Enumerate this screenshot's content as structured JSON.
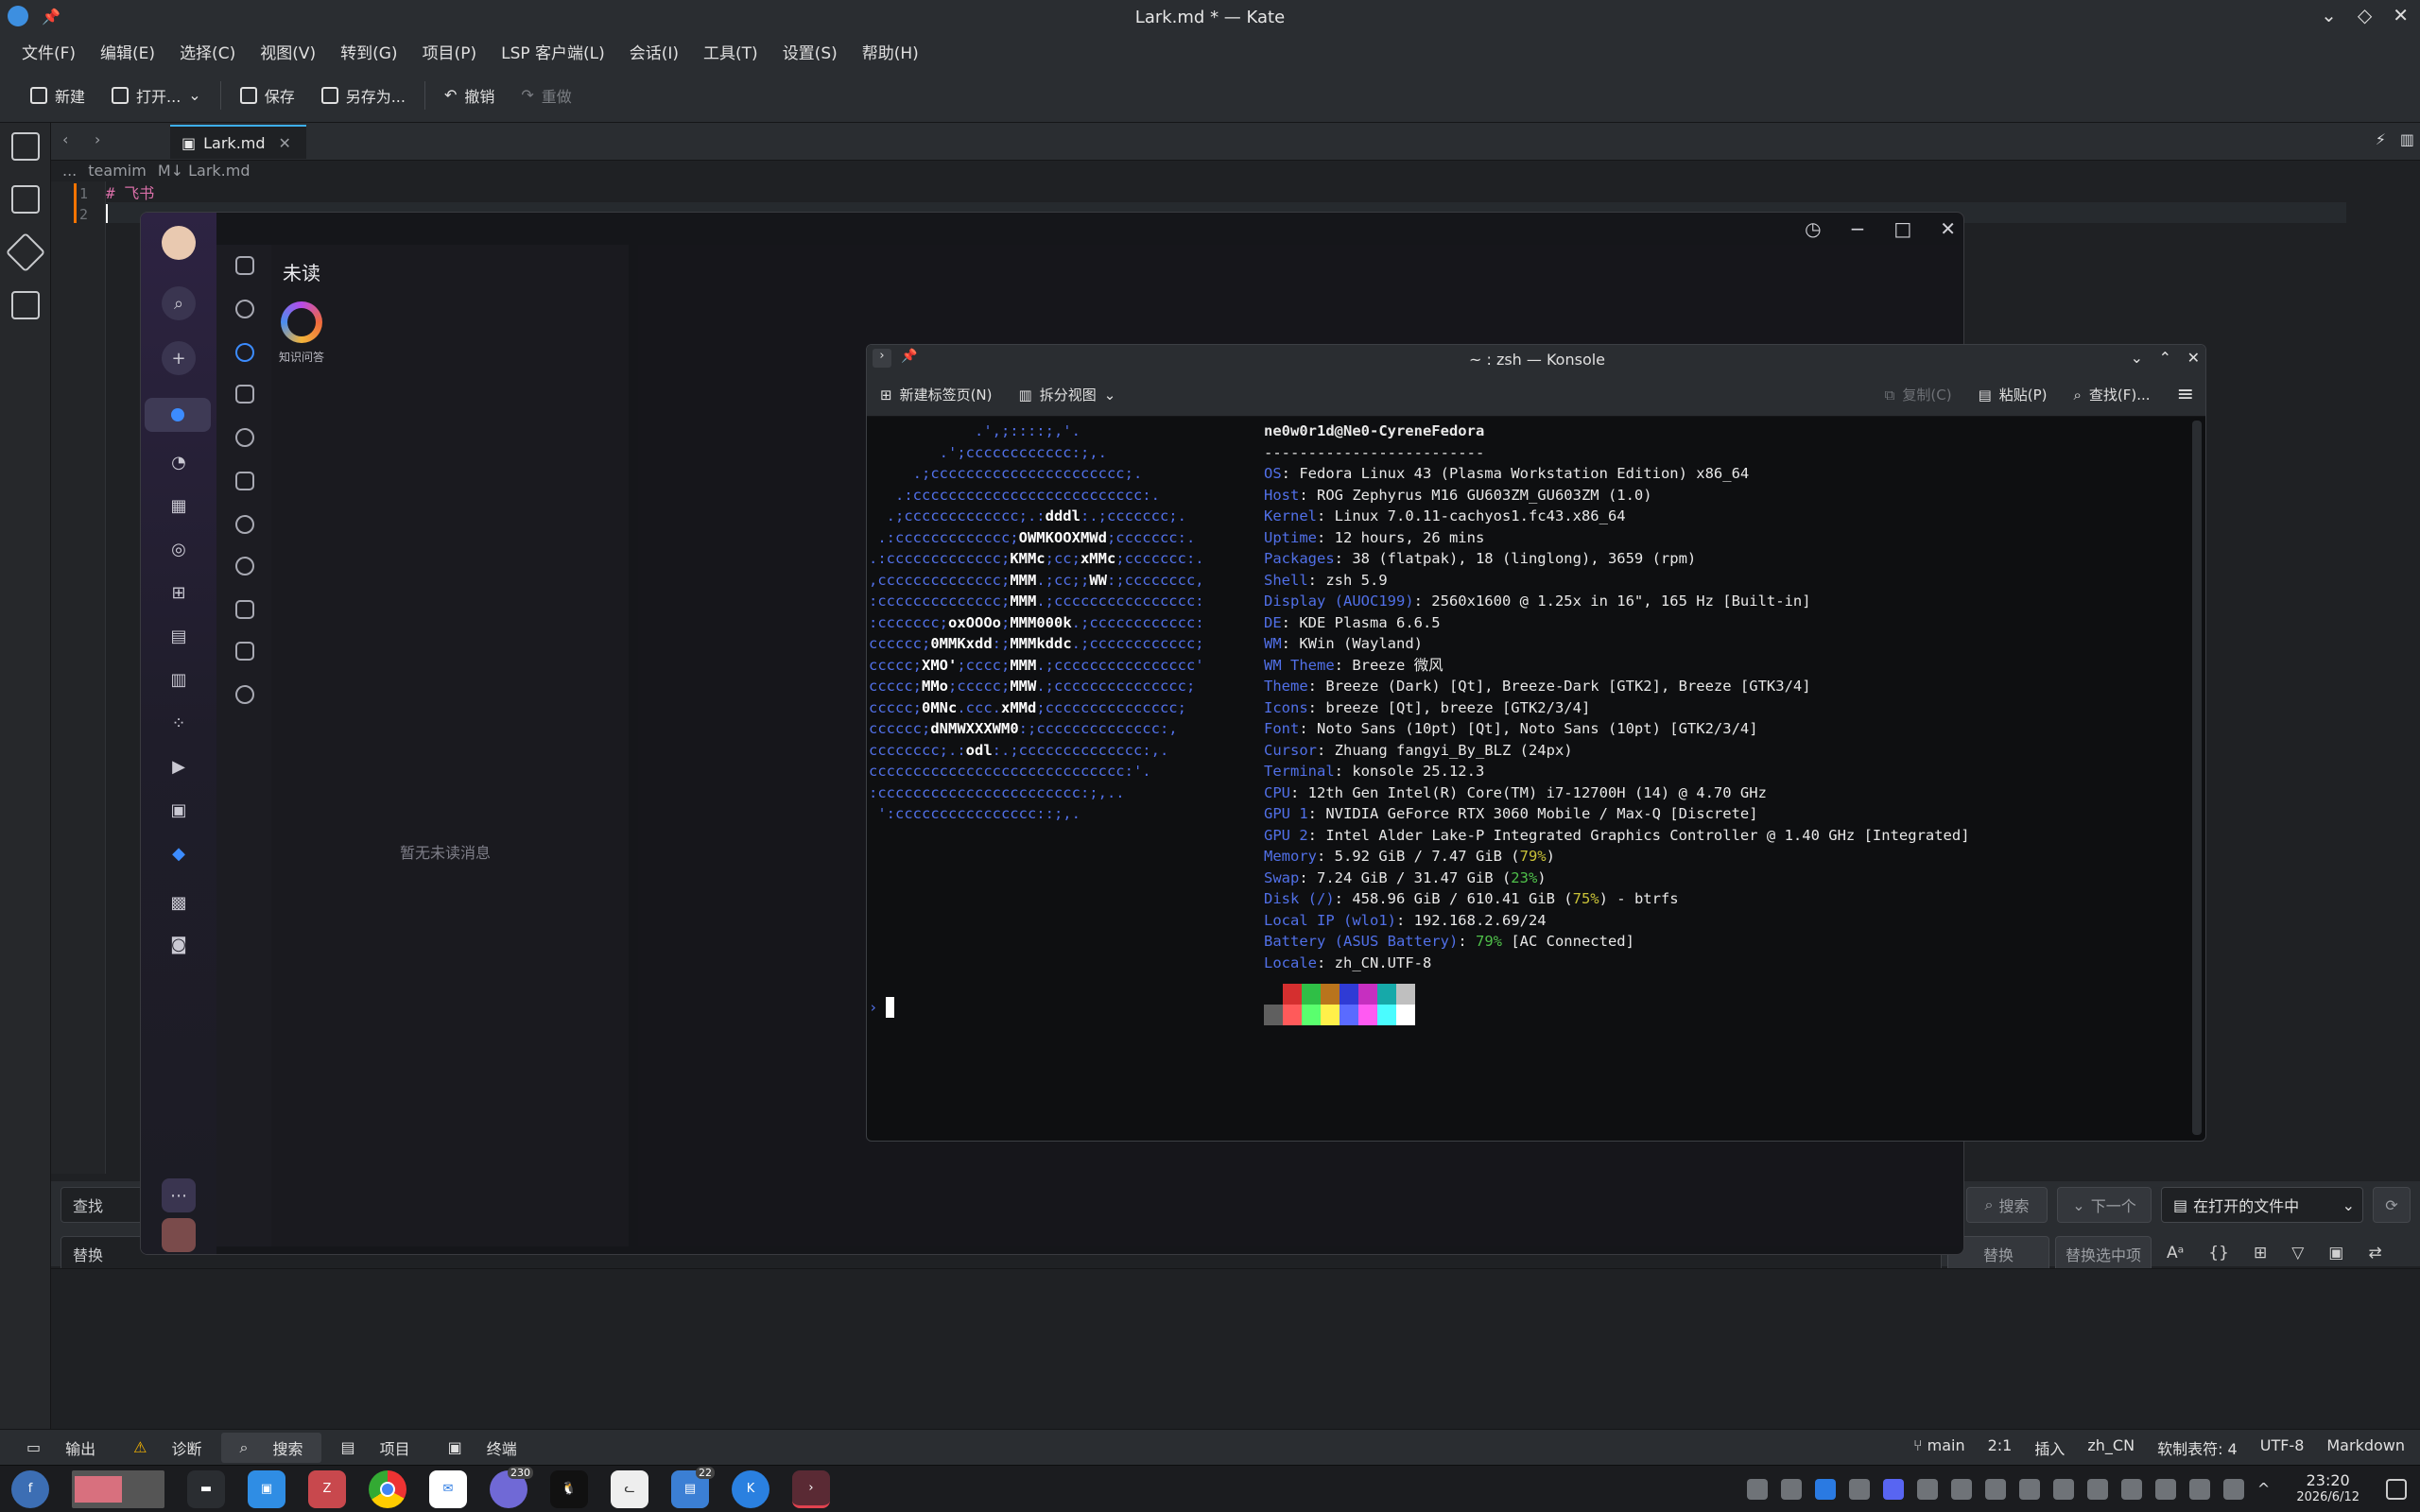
{
  "kate": {
    "window_title": "Lark.md * — Kate",
    "menu": [
      "文件(F)",
      "编辑(E)",
      "选择(C)",
      "视图(V)",
      "转到(G)",
      "项目(P)",
      "LSP 客户端(L)",
      "会话(I)",
      "工具(T)",
      "设置(S)",
      "帮助(H)"
    ],
    "toolbar": {
      "new": "新建",
      "open": "打开...",
      "save": "保存",
      "save_as": "另存为...",
      "undo": "撤销",
      "redo": "重做"
    },
    "tab_label": "Lark.md",
    "breadcrumb": [
      "...",
      "teamim",
      "M↓ Lark.md"
    ],
    "line_numbers": [
      "1",
      "2"
    ],
    "line1": "# 飞书",
    "find": {
      "find_placeholder": "查找",
      "replace_placeholder": "替换",
      "search": "搜索",
      "next": "下一个",
      "scope": "在打开的文件中",
      "replace": "替换",
      "replace_selected": "替换选中项"
    },
    "statusbar": {
      "tabs": [
        "输出",
        "诊断",
        "搜索",
        "项目",
        "终端"
      ],
      "branch": "main",
      "position": "2:1",
      "mode": "插入",
      "lang": "zh_CN",
      "tabs_setting": "软制表符: 4",
      "encoding": "UTF-8",
      "syntax": "Markdown"
    }
  },
  "feishu": {
    "list_title": "未读",
    "item_label": "知识问答",
    "empty_text": "暂无未读消息"
  },
  "konsole": {
    "title": "~ : zsh — Konsole",
    "toolbar": {
      "new_tab": "新建标签页(N)",
      "split": "拆分视图",
      "copy": "复制(C)",
      "paste": "粘贴(P)",
      "find": "查找(F)..."
    },
    "logo_lines": [
      "            .',;::::;,'.",
      "        .';cccccccccccc:;,.",
      "     .;cccccccccccccccccccccc;.",
      "   .:cccccccccccccccccccccccccc:.",
      "  .;ccccccccccccc;.:dddl:.;ccccccc;.",
      " .:ccccccccccccc;OWMKOOXMWd;ccccccc:.",
      ".:ccccccccccccc;KMMc;cc;xMMc;ccccccc:.",
      ",cccccccccccccc;MMM.;cc;;WW:;cccccccc,",
      ":cccccccccccccc;MMM.;cccccccccccccccc:",
      ":ccccccc;oxOOOo;MMM000k.;cccccccccccc:",
      "cccccc;0MMKxdd:;MMMkddc.;cccccccccccc;",
      "ccccc;XMO';cccc;MMM.;cccccccccccccccc'",
      "ccccc;MMo;ccccc;MMW.;ccccccccccccccc;",
      "ccccc;0MNc.ccc.xMMd;ccccccccccccccc;",
      "cccccc;dNMWXXXWM0:;cccccccccccccc:,",
      "cccccccc;.:odl:.;cccccccccccccc:,.",
      "ccccccccccccccccccccccccccccc:'.",
      ":ccccccccccccccccccccccc:;,..",
      " ':cccccccccccccccc::;,."
    ],
    "user_host": "ne0w0r1d@Ne0-CyreneFedora",
    "separator": "-------------------------",
    "info": [
      {
        "k": "OS",
        "v": ": Fedora Linux 43 (Plasma Workstation Edition) x86_64"
      },
      {
        "k": "Host",
        "v": ": ROG Zephyrus M16 GU603ZM_GU603ZM (1.0)"
      },
      {
        "k": "Kernel",
        "v": ": Linux 7.0.11-cachyos1.fc43.x86_64"
      },
      {
        "k": "Uptime",
        "v": ": 12 hours, 26 mins"
      },
      {
        "k": "Packages",
        "v": ": 38 (flatpak), 18 (linglong), 3659 (rpm)"
      },
      {
        "k": "Shell",
        "v": ": zsh 5.9"
      },
      {
        "k": "Display (AUOC199)",
        "v": ": 2560x1600 @ 1.25x in 16\", 165 Hz [Built-in]"
      },
      {
        "k": "DE",
        "v": ": KDE Plasma 6.6.5"
      },
      {
        "k": "WM",
        "v": ": KWin (Wayland)"
      },
      {
        "k": "WM Theme",
        "v": ": Breeze 微风"
      },
      {
        "k": "Theme",
        "v": ": Breeze (Dark) [Qt], Breeze-Dark [GTK2], Breeze [GTK3/4]"
      },
      {
        "k": "Icons",
        "v": ": breeze [Qt], breeze [GTK2/3/4]"
      },
      {
        "k": "Font",
        "v": ": Noto Sans (10pt) [Qt], Noto Sans (10pt) [GTK2/3/4]"
      },
      {
        "k": "Cursor",
        "v": ": Zhuang fangyi_By_BLZ (24px)"
      },
      {
        "k": "Terminal",
        "v": ": konsole 25.12.3"
      },
      {
        "k": "CPU",
        "v": ": 12th Gen Intel(R) Core(TM) i7-12700H (14) @ 4.70 GHz"
      },
      {
        "k": "GPU 1",
        "v": ": NVIDIA GeForce RTX 3060 Mobile / Max-Q [Discrete]"
      },
      {
        "k": "GPU 2",
        "v": ": Intel Alder Lake-P Integrated Graphics Controller @ 1.40 GHz [Integrated]"
      }
    ],
    "memory": {
      "k": "Memory",
      "v1": ": 5.92 GiB / 7.47 GiB (",
      "p": "79%",
      "v2": ")"
    },
    "swap": {
      "k": "Swap",
      "v1": ": 7.24 GiB / 31.47 GiB (",
      "p": "23%",
      "v2": ")"
    },
    "disk": {
      "k": "Disk (/)",
      "v1": ": 458.96 GiB / 610.41 GiB (",
      "p": "75%",
      "v2": ") - btrfs"
    },
    "localip": {
      "k": "Local IP (wlo1)",
      "v": ": 192.168.2.69/24"
    },
    "battery": {
      "k": "Battery (ASUS Battery)",
      "v1": ": ",
      "p": "79%",
      "v2": " [AC Connected]"
    },
    "locale": {
      "k": "Locale",
      "v": ": zh_CN.UTF-8"
    },
    "palette_top": [
      "#0e0f11",
      "#d52f2f",
      "#2fbf46",
      "#b9741c",
      "#2f3bd5",
      "#c62fc0",
      "#16a9a9",
      "#bfbfbf"
    ],
    "palette_bottom": [
      "#5f5f5f",
      "#ff5a5a",
      "#5aff6e",
      "#fff04a",
      "#5a6bff",
      "#ff5af2",
      "#4afcff",
      "#ffffff"
    ]
  },
  "taskbar": {
    "badge_qq": "230",
    "badge_chat": "22",
    "time": "23:20",
    "date": "2026/6/12"
  }
}
